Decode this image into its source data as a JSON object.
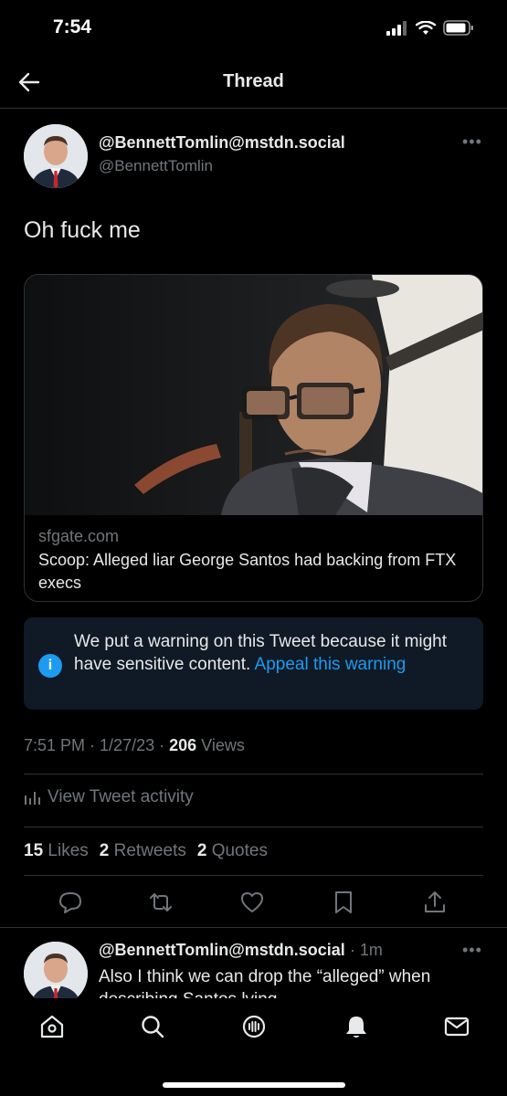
{
  "status": {
    "time": "7:54"
  },
  "header": {
    "title": "Thread"
  },
  "tweet": {
    "name": "@BennettTomlin@mstdn.social",
    "handle": "@BennettTomlin",
    "text": "Oh fuck me",
    "card": {
      "domain": "sfgate.com",
      "title": "Scoop: Alleged liar George Santos had backing from FTX execs"
    },
    "warning": {
      "text": "We put a warning on this Tweet because it might have sensitive content.",
      "link": "Appeal this warning"
    },
    "meta": {
      "time": "7:51 PM",
      "date": "1/27/23",
      "views_count": "206",
      "views_label": "Views"
    },
    "activity_label": "View Tweet activity",
    "stats": {
      "likes_count": "15",
      "likes_label": "Likes",
      "retweets_count": "2",
      "retweets_label": "Retweets",
      "quotes_count": "2",
      "quotes_label": "Quotes"
    }
  },
  "reply": {
    "name": "@BennettTomlin@mstdn.social",
    "time": "1m",
    "text": "Also I think we can drop the “alleged” when describing Santos lying"
  },
  "colors": {
    "accent": "#1d9bf0",
    "background": "#000000",
    "warning_bg": "#101a26"
  },
  "icons": [
    "back-arrow-icon",
    "more-icon",
    "info-icon",
    "reply-icon",
    "retweet-icon",
    "like-icon",
    "bookmark-icon",
    "share-icon",
    "home-icon",
    "search-icon",
    "spaces-icon",
    "notifications-icon",
    "messages-icon",
    "activity-chart-icon"
  ]
}
